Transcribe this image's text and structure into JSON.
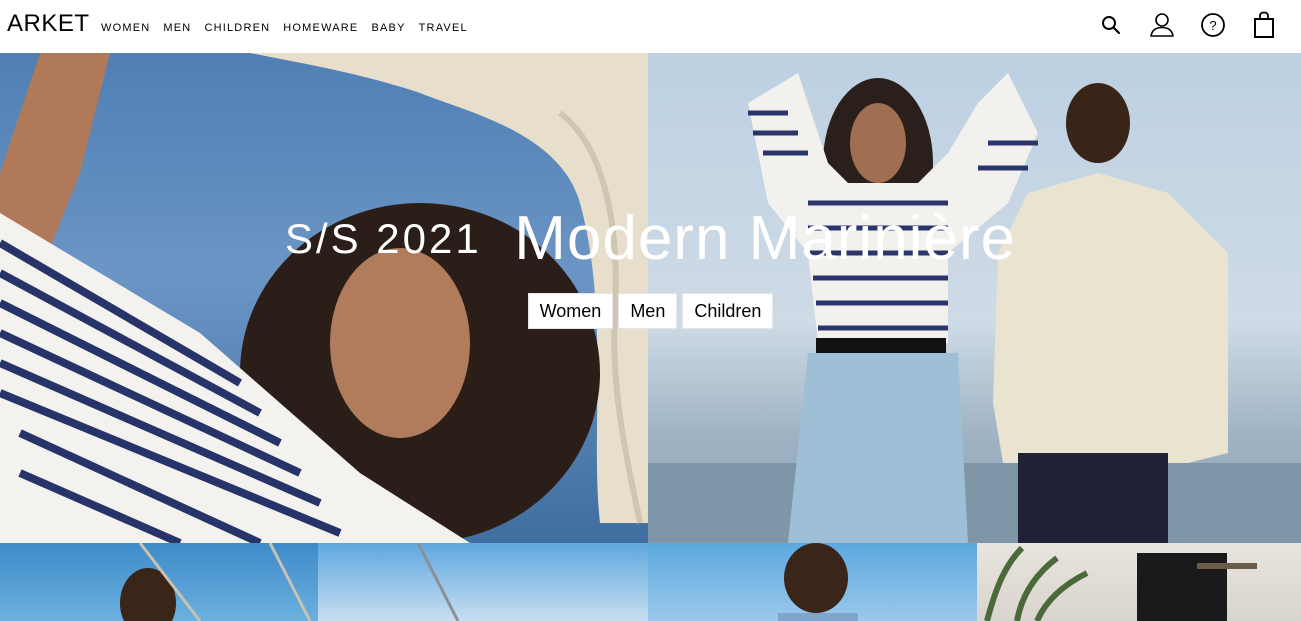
{
  "header": {
    "logo": "ARKET",
    "nav": [
      {
        "label": "WOMEN"
      },
      {
        "label": "MEN"
      },
      {
        "label": "CHILDREN"
      },
      {
        "label": "HOMEWARE"
      },
      {
        "label": "BABY"
      },
      {
        "label": "TRAVEL"
      }
    ],
    "icons": [
      "search-icon",
      "account-icon",
      "help-icon",
      "bag-icon"
    ]
  },
  "hero": {
    "season": "S/S 2021",
    "title": "Modern Marinière",
    "buttons": [
      {
        "label": "Women"
      },
      {
        "label": "Men"
      },
      {
        "label": "Children"
      }
    ]
  },
  "colors": {
    "text": "#000000",
    "hero_text": "#ffffff",
    "button_bg": "#ffffff"
  }
}
